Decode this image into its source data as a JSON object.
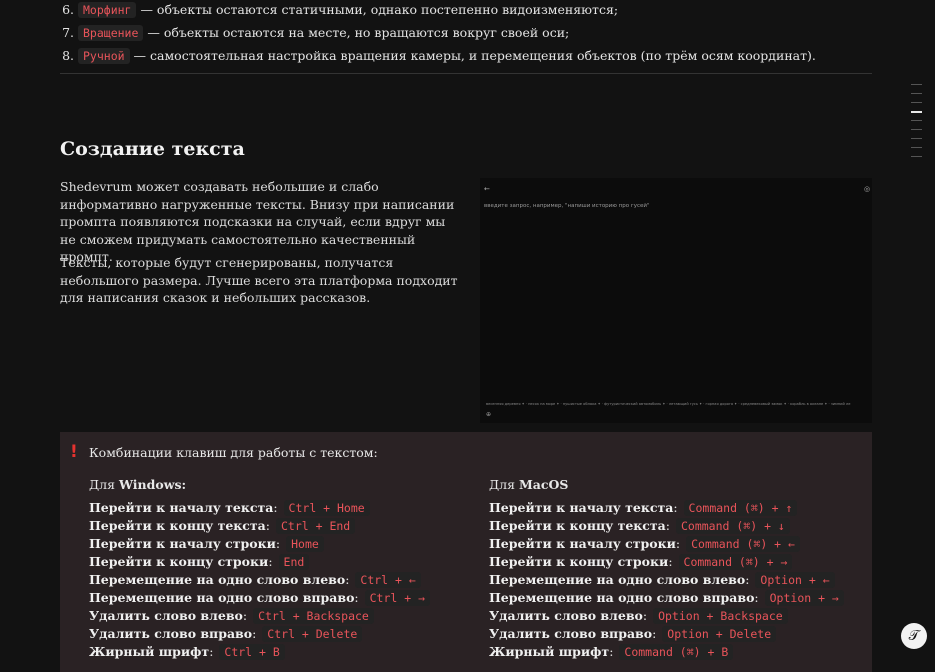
{
  "list": [
    {
      "num": "6.",
      "code": "Морфинг",
      "text": "— объекты остаются статичными, однако постепенно видоизменяются;"
    },
    {
      "num": "7.",
      "code": "Вращение",
      "text": "— объекты остаются на месте, но вращаются вокруг своей оси;"
    },
    {
      "num": "8.",
      "code": "Ручной",
      "text": "— самостоятельная настройка вращения камеры, и перемещения объектов (по трём осям координат)."
    }
  ],
  "section": {
    "title": "Создание текста",
    "paragraphs": [
      "Shedevrum может создавать небольшие и слабо информативно нагруженные тексты. Внизу при написании промпта появляются подсказки на случай, если вдруг мы не сможем придумать самостоятельно качественный промпт.",
      "Тексты, которые будут сгенерированы, получатся небольшого размера. Лучше всего эта платформа подходит для написания сказок и небольших рассказов."
    ]
  },
  "screenshot": {
    "back": "←",
    "corner": "◎",
    "prompt": "введите запрос, например, \"напиши историю про гусей\"",
    "chips": "весенняя деревня ✦ · песок на море ✦ · пушистые облака ✦ · футуристический автомобиль ✦ · летающий гусь ✦ · горная дорога ✦ · средневековый замок ✦ · корабль в океане ✦ · зимний ле",
    "small": "⊕"
  },
  "callout": {
    "icon": "!",
    "intro": "Комбинации клавиш для работы с текстом:",
    "windows": {
      "head_pre": "Для ",
      "head_bold": "Windows:",
      "items": [
        {
          "label": "Перейти к началу текста",
          "keys": "Ctrl + Home"
        },
        {
          "label": "Перейти к концу текста",
          "keys": "Ctrl + End"
        },
        {
          "label": "Перейти к началу строки",
          "keys": "Home"
        },
        {
          "label": "Перейти к концу строки",
          "keys": "End"
        },
        {
          "label": "Перемещение на одно слово влево",
          "keys": "Ctrl + ←"
        },
        {
          "label": "Перемещение на одно слово вправо",
          "keys": "Ctrl + →"
        },
        {
          "label": "Удалить слово влево",
          "keys": "Ctrl + Backspace"
        },
        {
          "label": "Удалить слово вправо",
          "keys": "Ctrl + Delete"
        },
        {
          "label": "Жирный шрифт",
          "keys": "Ctrl + B"
        }
      ]
    },
    "mac": {
      "head_pre": "Для ",
      "head_bold": "MacOS",
      "items": [
        {
          "label": "Перейти к началу текста",
          "keys": "Command (⌘) + ↑"
        },
        {
          "label": "Перейти к концу текста",
          "keys": "Command (⌘) + ↓"
        },
        {
          "label": "Перейти к началу строки",
          "keys": "Command (⌘) + ←"
        },
        {
          "label": "Перейти к концу строки",
          "keys": "Command (⌘) + →"
        },
        {
          "label": "Перемещение на одно слово влево",
          "keys": "Option + ←"
        },
        {
          "label": "Перемещение на одно слово вправо",
          "keys": "Option + →"
        },
        {
          "label": "Удалить слово влево",
          "keys": "Option + Backspace"
        },
        {
          "label": "Удалить слово вправо",
          "keys": "Option + Delete"
        },
        {
          "label": "Жирный шрифт",
          "keys": "Command (⌘) + B"
        }
      ]
    }
  },
  "colon": ":",
  "fab_icon": "𝒯"
}
